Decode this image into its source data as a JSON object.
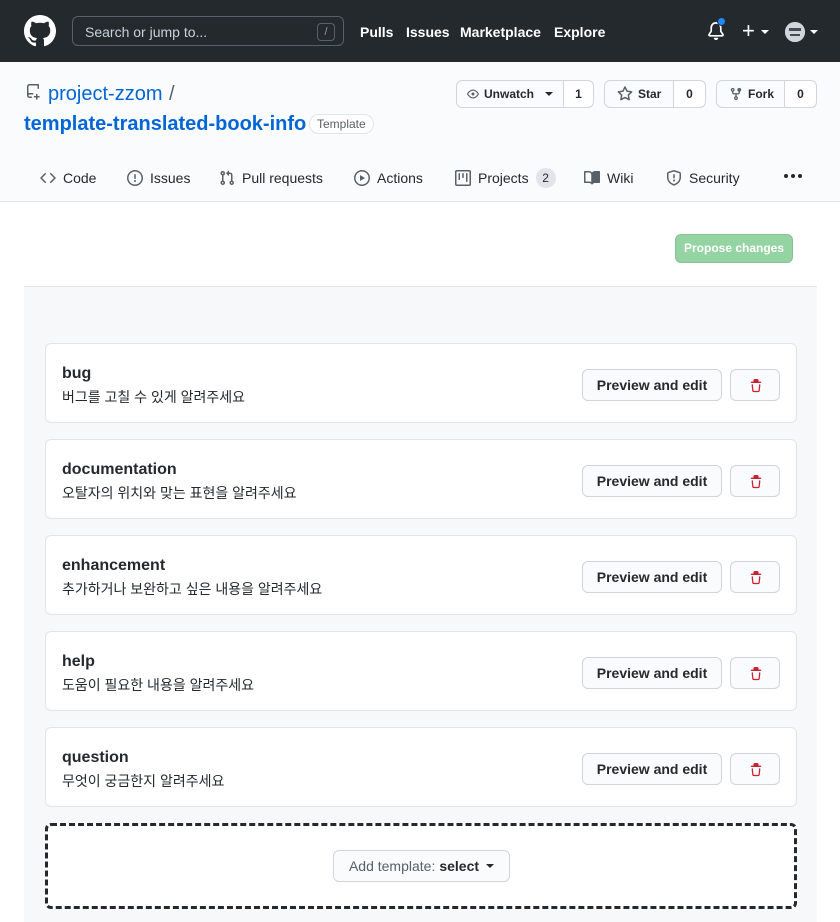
{
  "header": {
    "search_placeholder": "Search or jump to...",
    "search_shortcut": "/",
    "nav": [
      "Pulls",
      "Issues",
      "Marketplace",
      "Explore"
    ]
  },
  "repo": {
    "owner": "project-zzom",
    "separator": "/",
    "name": "template-translated-book-info",
    "badge": "Template",
    "watch_label": "Unwatch",
    "watch_count": "1",
    "star_label": "Star",
    "star_count": "0",
    "fork_label": "Fork",
    "fork_count": "0"
  },
  "tabs": [
    {
      "label": "Code"
    },
    {
      "label": "Issues"
    },
    {
      "label": "Pull requests"
    },
    {
      "label": "Actions"
    },
    {
      "label": "Projects",
      "count": "2"
    },
    {
      "label": "Wiki"
    },
    {
      "label": "Security"
    }
  ],
  "propose_label": "Propose changes",
  "templates": [
    {
      "name": "bug",
      "desc": "버그를 고칠 수 있게 알려주세요"
    },
    {
      "name": "documentation",
      "desc": "오탈자의 위치와 맞는 표현을 알려주세요"
    },
    {
      "name": "enhancement",
      "desc": "추가하거나 보완하고 싶은 내용을 알려주세요"
    },
    {
      "name": "help",
      "desc": "도움이 필요한 내용을 알려주세요"
    },
    {
      "name": "question",
      "desc": "무엇이 궁금한지 알려주세요"
    }
  ],
  "preview_label": "Preview and edit",
  "add_template": {
    "label": "Add template:",
    "value": "select"
  },
  "colors": {
    "header_bg": "#24292e",
    "link": "#0366d6",
    "propose_disabled": "#94d3a2",
    "danger": "#cb2431",
    "notification": "#2188ff"
  }
}
